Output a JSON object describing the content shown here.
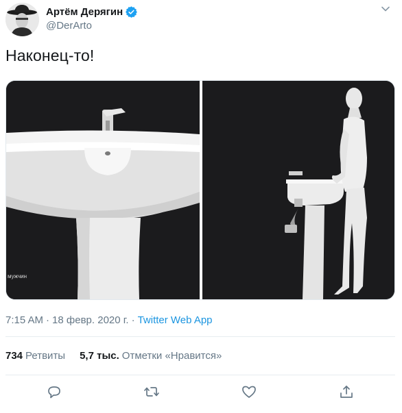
{
  "author": {
    "display_name": "Артём Дерягин",
    "handle": "@DerArto",
    "verified": true,
    "avatar_icon": "cowboy-hat-avatar"
  },
  "tweet": {
    "text": "Наконец-то!",
    "media_caption": "мужчин"
  },
  "meta": {
    "time": "7:15 AM",
    "separator": "·",
    "date": "18 февр. 2020 г.",
    "source": "Twitter Web App"
  },
  "stats": {
    "retweets_count": "734",
    "retweets_label": "Ретвиты",
    "likes_count": "5,7 тыс.",
    "likes_label": "Отметки «Нравится»"
  },
  "actions": [
    {
      "icon": "reply-icon"
    },
    {
      "icon": "retweet-icon"
    },
    {
      "icon": "like-icon"
    },
    {
      "icon": "share-icon"
    }
  ],
  "colors": {
    "accent": "#1b95e0",
    "verified": "#1da1f2",
    "muted": "#657786",
    "text": "#14171a",
    "media_bg": "#1b1b1d"
  }
}
